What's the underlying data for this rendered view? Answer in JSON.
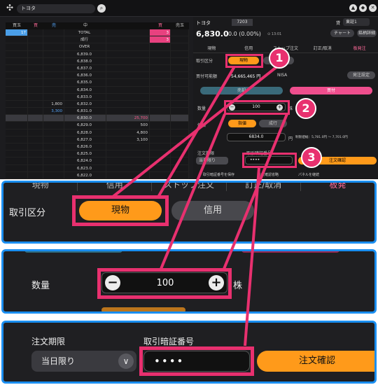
{
  "topbar": {
    "search_value": "トヨタ",
    "window_buttons": [
      "▲",
      "◆",
      "✕"
    ]
  },
  "board": {
    "headers": [
      "買玉",
      "買",
      "売",
      "中",
      "",
      "買",
      "売玉"
    ],
    "rows": [
      {
        "c1": "17",
        "c2": "",
        "c3": "",
        "c4": "TOTAL",
        "c5": "",
        "c6": "3",
        "c7": ""
      },
      {
        "c1": "",
        "c2": "",
        "c3": "",
        "c4": "成行",
        "c5": "",
        "c6": "3",
        "c7": ""
      },
      {
        "c1": "",
        "c2": "",
        "c3": "",
        "c4": "OVER",
        "c5": "",
        "c6": "",
        "c7": ""
      },
      {
        "c1": "",
        "c2": "",
        "c3": "",
        "c4": "6,839.0",
        "c5": "",
        "c6": "",
        "c7": ""
      },
      {
        "c1": "",
        "c2": "",
        "c3": "",
        "c4": "6,838.0",
        "c5": "",
        "c6": "",
        "c7": ""
      },
      {
        "c1": "",
        "c2": "",
        "c3": "",
        "c4": "6,837.0",
        "c5": "",
        "c6": "",
        "c7": ""
      },
      {
        "c1": "",
        "c2": "",
        "c3": "",
        "c4": "6,836.0",
        "c5": "",
        "c6": "",
        "c7": ""
      },
      {
        "c1": "",
        "c2": "",
        "c3": "",
        "c4": "6,835.0",
        "c5": "",
        "c6": "",
        "c7": ""
      },
      {
        "c1": "",
        "c2": "",
        "c3": "",
        "c4": "6,834.0",
        "c5": "",
        "c6": "",
        "c7": ""
      },
      {
        "c1": "",
        "c2": "",
        "c3": "",
        "c4": "6,833.0",
        "c5": "",
        "c6": "",
        "c7": ""
      },
      {
        "c1": "",
        "c2": "",
        "c3": "1,800",
        "c4": "6,832.0",
        "c5": "",
        "c6": "",
        "c7": ""
      },
      {
        "c1": "",
        "c2": "",
        "c3": "3,300",
        "c4": "6,831.0",
        "c5": "",
        "c6": "",
        "c7": ""
      },
      {
        "c1": "",
        "c2": "",
        "c3": "",
        "c4": "6,830.0",
        "c5": "25,700",
        "c6": "",
        "c7": ""
      },
      {
        "c1": "",
        "c2": "",
        "c3": "",
        "c4": "6,829.0",
        "c5": "500",
        "c6": "",
        "c7": ""
      },
      {
        "c1": "",
        "c2": "",
        "c3": "",
        "c4": "6,828.0",
        "c5": "4,800",
        "c6": "",
        "c7": ""
      },
      {
        "c1": "",
        "c2": "",
        "c3": "",
        "c4": "6,827.0",
        "c5": "3,100",
        "c6": "",
        "c7": ""
      },
      {
        "c1": "",
        "c2": "",
        "c3": "",
        "c4": "6,826.0",
        "c5": "",
        "c6": "",
        "c7": ""
      },
      {
        "c1": "",
        "c2": "",
        "c3": "",
        "c4": "6,825.0",
        "c5": "",
        "c6": "",
        "c7": ""
      },
      {
        "c1": "",
        "c2": "",
        "c3": "",
        "c4": "6,824.0",
        "c5": "",
        "c6": "",
        "c7": ""
      },
      {
        "c1": "",
        "c2": "",
        "c3": "",
        "c4": "6,823.0",
        "c5": "",
        "c6": "",
        "c7": ""
      },
      {
        "c1": "",
        "c2": "",
        "c3": "",
        "c4": "6,822.0",
        "c5": "",
        "c6": "",
        "c7": ""
      }
    ]
  },
  "order_panel": {
    "stock_name": "トヨタ",
    "stock_code": "7203",
    "market_label": "貸",
    "market": "東証1",
    "price": "6,830.0",
    "change": "0.0 (0.00%)",
    "time": "⊙ 13:01",
    "chart_btn": "チャート",
    "info_btn": "銘柄詳細",
    "tabs": [
      "現物",
      "信用",
      "ストップ注文",
      "訂正/取消",
      "板発注"
    ],
    "trade_type_label": "取引区分",
    "trade_type_spot": "現物",
    "trade_type_margin": "信用",
    "buying_power_label": "買付可能額",
    "buying_power": "54,665,465 円",
    "nisa_label": "NISA",
    "order_settings_btn": "発注設定",
    "sell_btn": "売却",
    "buy_btn": "買付",
    "qty_label": "数量",
    "qty_value": "100",
    "qty_unit": "株",
    "price_label": "価格",
    "limit_btn": "指値",
    "market_btn": "成行",
    "price_value": "6834.0",
    "price_unit": "円",
    "price_limit_text": "制限値幅：5,781.0円 ～ 7,701.0円",
    "term_label": "注文期限",
    "term_value": "当日限り",
    "pin_label": "取引暗証番号",
    "pin_value": "••••",
    "confirm_btn": "注文確認",
    "save_pin": "取引暗証番号を保存",
    "skip_confirm": "注文確認省略",
    "keep_panel": "パネルを継続"
  },
  "zoom1": {
    "tabs": [
      "現物",
      "信用",
      "ストップ注文",
      "訂正/取消",
      "板発"
    ],
    "label": "取引区分",
    "spot": "現物",
    "margin": "信用"
  },
  "zoom2": {
    "label": "数量",
    "minus": "−",
    "value": "100",
    "plus": "+",
    "unit": "株"
  },
  "zoom3": {
    "term_label": "注文期限",
    "term_value": "当日限り",
    "chevron": "∨",
    "pin_label": "取引暗証番号",
    "pin_value": "••••",
    "confirm": "注文確認"
  },
  "markers": [
    "1",
    "2",
    "3"
  ],
  "colors": {
    "accent_pink": "#e8306f",
    "accent_orange": "#ff9a1a",
    "frame_blue": "#1a8ef0"
  }
}
